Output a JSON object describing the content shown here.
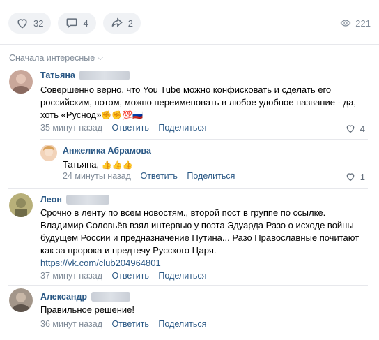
{
  "actions": {
    "likes": "32",
    "comments": "4",
    "shares": "2",
    "views": "221"
  },
  "sort_label": "Сначала интересные",
  "icons": {
    "like": "heart-icon",
    "comment": "comment-bubble-icon",
    "share": "share-arrow-icon",
    "views": "eye-icon",
    "sort": "chevron-down-icon"
  },
  "comments": [
    {
      "author": "Татьяна",
      "text_lines": [
        "Совершенно верно, что You Tube можно конфисковать и сделать его",
        "российским, потом, можно переименовать в любое удобное название - да,",
        "хоть «Руснод»"
      ],
      "emoji": "✊✊💯🇷🇺",
      "time": "35 минут назад",
      "reply": "Ответить",
      "share": "Поделиться",
      "likes": "4"
    },
    {
      "author": "Анжелика Абрамова",
      "text": "Татьяна,",
      "emoji": "👍👍👍",
      "time": "24 минуты назад",
      "reply": "Ответить",
      "share": "Поделиться",
      "likes": "1"
    },
    {
      "author": "Леон",
      "text_lines": [
        "Срочно в ленту по всем новостям., второй пост в группе по ссылке.",
        "Владимир Соловьёв взял интервью у поэта Эдуарда Разо о исходе войны",
        "будущем России и предназначение Путина... Разо Православные почитают",
        "как за пророка и предтечу Русского Царя."
      ],
      "link": "https://vk.com/club204964801",
      "time": "37 минут назад",
      "reply": "Ответить",
      "share": "Поделиться"
    },
    {
      "author": "Александр",
      "text": "Правильное решение!",
      "time": "36 минут назад",
      "reply": "Ответить",
      "share": "Поделиться"
    }
  ],
  "colors": {
    "link": "#2a5885",
    "muted": "#818c99",
    "pill_bg": "#f0f2f5",
    "divider": "#e7e8ec"
  }
}
